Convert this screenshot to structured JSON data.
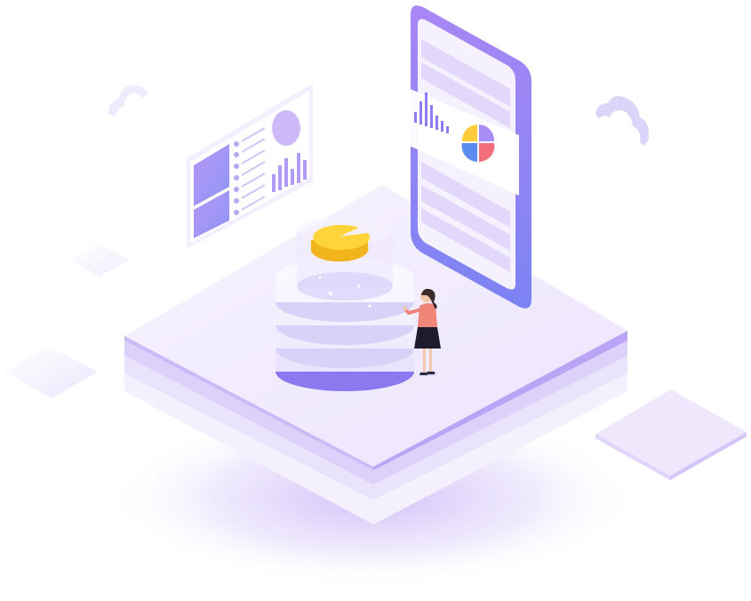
{
  "illustration": {
    "kind": "isometric-data-analytics",
    "colors": {
      "primary_purple": "#8f7bf2",
      "light_purple": "#e6dcfb",
      "platform_top": "#f3eefe",
      "coin_yellow": "#ffd43a",
      "pie_blue": "#5b8def",
      "pie_red": "#f36f7d",
      "pie_yellow": "#ffcd3c",
      "pie_purple": "#a98cf5",
      "person_top": "#f08579",
      "person_skirt": "#1c1c2e"
    },
    "icons": [
      "cloud-icon",
      "dashboard-panel-icon",
      "smartphone-icon",
      "bar-chart-icon",
      "pie-chart-icon",
      "database-stack-icon",
      "person-icon"
    ]
  }
}
